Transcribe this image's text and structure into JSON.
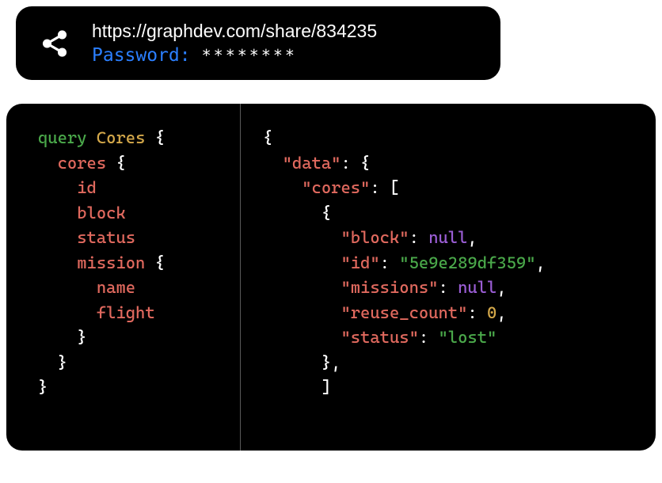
{
  "share": {
    "url": "https://graphdev.com/share/834235",
    "password_label": "Password:",
    "password_masked": "********"
  },
  "query": {
    "keyword": "query",
    "operation_name": "Cores",
    "root_field": "cores",
    "fields": [
      "id",
      "block",
      "status"
    ],
    "nested_field": "mission",
    "nested_fields": [
      "name",
      "flight"
    ]
  },
  "response": {
    "root_key": "\"data\"",
    "cores_key": "\"cores\"",
    "item": {
      "block_key": "\"block\"",
      "block_val": "null",
      "id_key": "\"id\"",
      "id_val": "\"5e9e289df359\"",
      "missions_key": "\"missions\"",
      "missions_val": "null",
      "reuse_key": "\"reuse_count\"",
      "reuse_val": "0",
      "status_key": "\"status\"",
      "status_val": "\"lost\""
    }
  }
}
